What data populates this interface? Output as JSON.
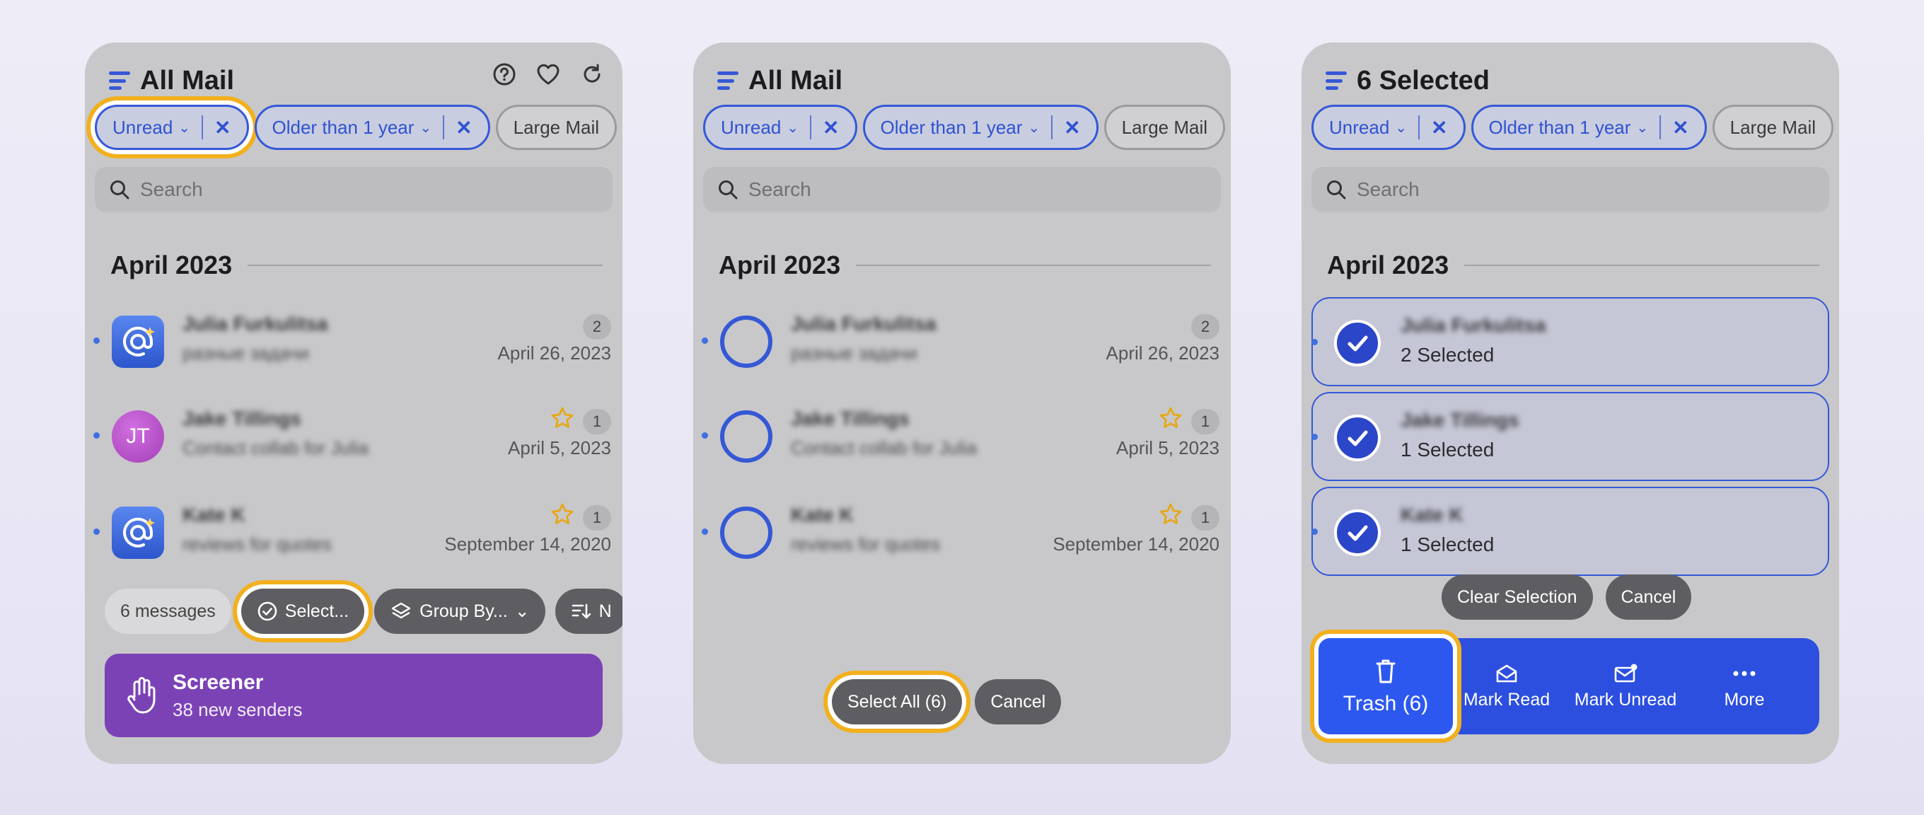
{
  "panels": [
    {
      "title": "All Mail",
      "chips": {
        "unread": "Unread",
        "older": "Older than 1 year",
        "large": "Large Mail"
      },
      "search_placeholder": "Search",
      "section": "April 2023",
      "rows": [
        {
          "name": "Julia Furkulitsa",
          "subject": "разные задачи",
          "count": "2",
          "date": "April 26, 2023",
          "avatar": "mail-icon"
        },
        {
          "name": "Jake Tillings",
          "subject": "Contact collab for Julia",
          "count": "1",
          "date": "April 5, 2023",
          "avatar": "JT",
          "starred": true
        },
        {
          "name": "Kate K",
          "subject": "reviews for quotes",
          "count": "1",
          "date": "September 14, 2020",
          "avatar": "mail-icon",
          "starred": true
        }
      ],
      "toolbar": {
        "messages": "6 messages",
        "select": "Select...",
        "group": "Group By...",
        "next": "N"
      },
      "screener": {
        "title": "Screener",
        "subtitle": "38 new senders"
      }
    },
    {
      "title": "All Mail",
      "chips": {
        "unread": "Unread",
        "older": "Older than 1 year",
        "large": "Large Mail"
      },
      "search_placeholder": "Search",
      "section": "April 2023",
      "rows": [
        {
          "name": "Julia Furkulitsa",
          "subject": "разные задачи",
          "count": "2",
          "date": "April 26, 2023"
        },
        {
          "name": "Jake Tillings",
          "subject": "Contact collab for Julia",
          "count": "1",
          "date": "April 5, 2023",
          "starred": true
        },
        {
          "name": "Kate K",
          "subject": "reviews for quotes",
          "count": "1",
          "date": "September 14, 2020",
          "starred": true
        }
      ],
      "select_all": "Select All (6)",
      "cancel": "Cancel"
    },
    {
      "title": "6 Selected",
      "chips": {
        "unread": "Unread",
        "older": "Older than 1 year",
        "large": "Large Mail"
      },
      "search_placeholder": "Search",
      "section": "April 2023",
      "rows": [
        {
          "name": "Julia Furkulitsa",
          "status": "2 Selected"
        },
        {
          "name": "Jake Tillings",
          "status": "1 Selected"
        },
        {
          "name": "Kate K",
          "status": "1 Selected"
        }
      ],
      "clear_selection": "Clear Selection",
      "cancel": "Cancel",
      "actions": {
        "trash": "Trash (6)",
        "mark_read": "Mark Read",
        "mark_unread": "Mark Unread",
        "more": "More"
      }
    }
  ],
  "colors": {
    "accent": "#3558d6",
    "highlight": "#f2b01e",
    "screener": "#7b42b6",
    "star": "#e6a817"
  }
}
